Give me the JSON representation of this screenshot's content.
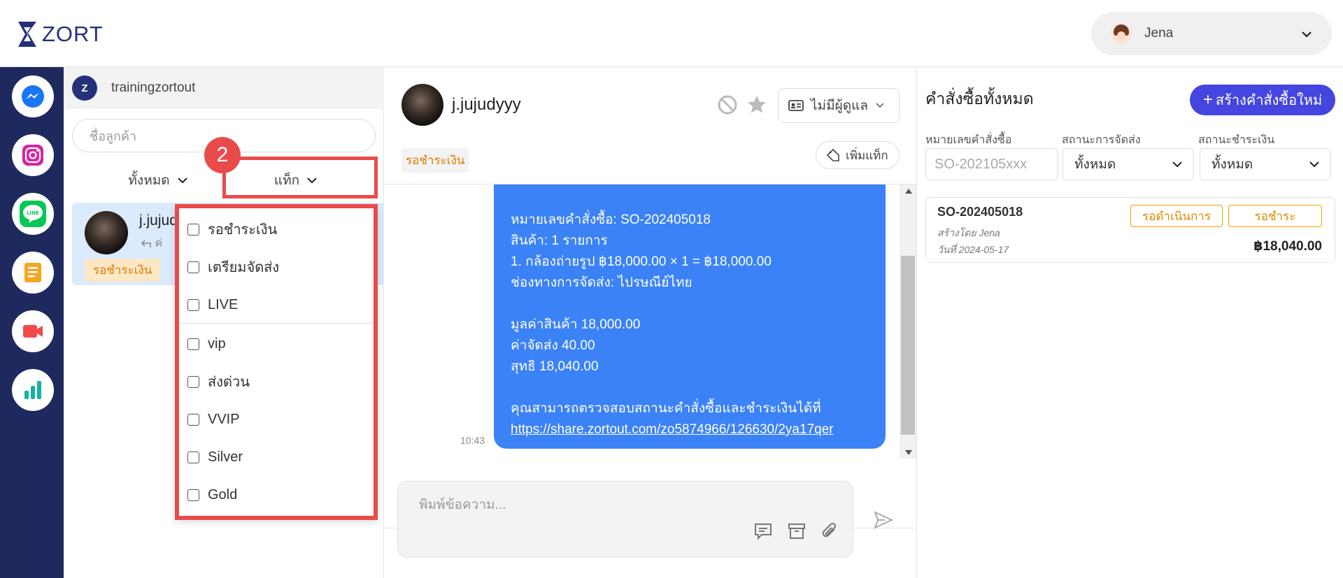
{
  "header": {
    "logo_text": "ZORT",
    "user_name": "Jena"
  },
  "rail": {
    "items": [
      "messenger-icon",
      "instagram-icon",
      "line-icon",
      "notes-icon",
      "video-icon",
      "analytics-icon"
    ]
  },
  "conversations": {
    "shop_name": "trainingzortout",
    "search_placeholder": "ชื่อลูกค้า",
    "filter_all": "ทั้งหมด",
    "filter_tag": "แท็ก",
    "step_number": "2",
    "items": [
      {
        "name": "j.jujud",
        "preview": "ค่",
        "tag": "รอชำระเงิน"
      }
    ]
  },
  "tag_dropdown": {
    "options": [
      "รอชำระเงิน",
      "เตรียมจัดส่ง",
      "LIVE",
      "vip",
      "ส่งด่วน",
      "VVIP",
      "Silver",
      "Gold"
    ]
  },
  "chat": {
    "contact_name": "j.jujudyyy",
    "assign_label": "ไม่มีผู้ดูแล",
    "tag": "รอชำระเงิน",
    "add_tag_label": "เพิ่มแท็ก",
    "message": {
      "lines_a": [
        "หมายเลขคำสั่งซื้อ: SO-202405018",
        "สินค้า: 1 รายการ",
        "1. กล้องถ่ายรูป ฿18,000.00 × 1 = ฿18,000.00",
        "ช่องทางการจัดส่ง: ไปรษณีย์ไทย"
      ],
      "lines_b": [
        "มูลค่าสินค้า 18,000.00",
        "ค่าจัดส่ง 40.00",
        "สุทธิ 18,040.00"
      ],
      "lines_c": [
        "คุณสามารถตรวจสอบสถานะคำสั่งซื้อและชำระเงินได้ที่"
      ],
      "link": "https://share.zortout.com/zo5874966/126630/2ya17qer",
      "time": "10:43"
    },
    "composer_placeholder": "พิมพ์ข้อความ..."
  },
  "orders": {
    "title": "คำสั่งซื้อทั้งหมด",
    "new_order_label": "สร้างคำสั่งซื้อใหม่",
    "filters": {
      "order_no_label": "หมายเลขคำสั่งซื้อ",
      "order_no_placeholder": "SO-202105xxx",
      "shipping_label": "สถานะการจัดส่ง",
      "shipping_value": "ทั้งหมด",
      "payment_label": "สถานะชำระเงิน",
      "payment_value": "ทั้งหมด"
    },
    "cards": [
      {
        "order_no": "SO-202405018",
        "created_by": "สร้างโดย Jena",
        "date": "วันที่ 2024-05-17",
        "status_1": "รอดำเนินการ",
        "status_2": "รอชำระ",
        "amount": "฿18,040.00"
      }
    ]
  },
  "colors": {
    "rail_bg": "#1e2a5e",
    "accent_blue": "#3b82f6",
    "primary_button": "#4545e0",
    "highlight_red": "#e94b4b",
    "tag_orange": "#e07a00"
  }
}
